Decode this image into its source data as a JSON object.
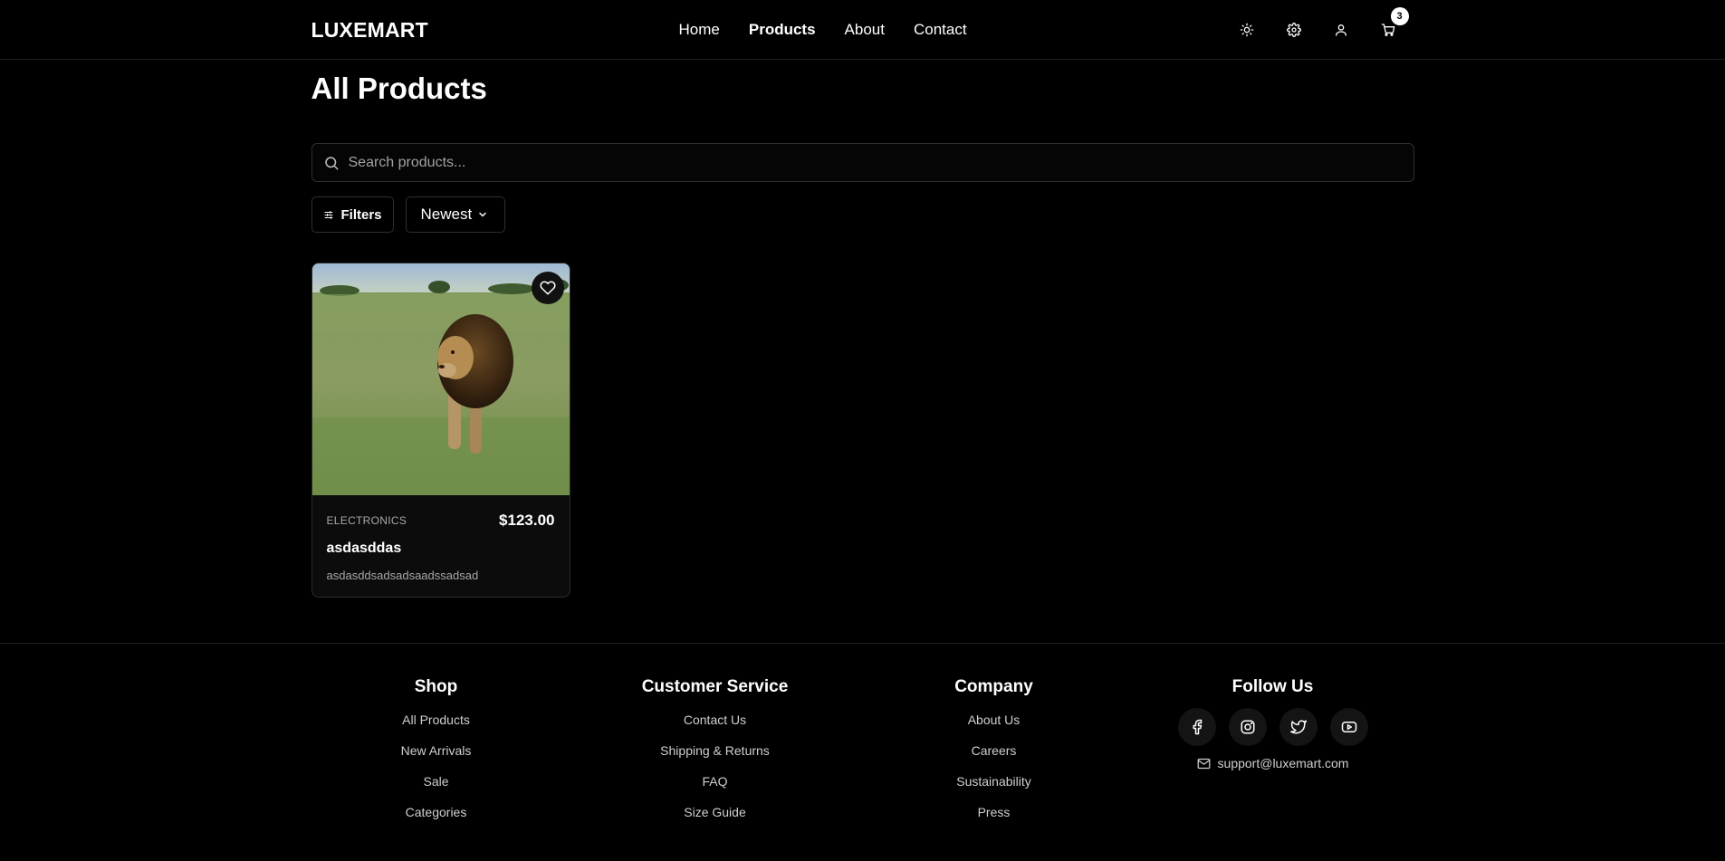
{
  "header": {
    "logo": "LUXEMART",
    "nav": [
      {
        "label": "Home",
        "active": false
      },
      {
        "label": "Products",
        "active": true
      },
      {
        "label": "About",
        "active": false
      },
      {
        "label": "Contact",
        "active": false
      }
    ],
    "icons": [
      "sun-icon",
      "gear-icon",
      "user-icon",
      "cart-icon"
    ],
    "cart_count": "3"
  },
  "main": {
    "title": "All Products",
    "search": {
      "placeholder": "Search products...",
      "value": ""
    },
    "filters_label": "Filters",
    "sort": {
      "selected": "Newest"
    }
  },
  "products": [
    {
      "category": "ELECTRONICS",
      "price": "$123.00",
      "name": "asdasddas",
      "description": "asdasddsadsadsaadssadsad",
      "image": "lion-in-grassland-photo"
    }
  ],
  "footer": {
    "columns": [
      {
        "title": "Shop",
        "links": [
          "All Products",
          "New Arrivals",
          "Sale",
          "Categories"
        ]
      },
      {
        "title": "Customer Service",
        "links": [
          "Contact Us",
          "Shipping & Returns",
          "FAQ",
          "Size Guide"
        ]
      },
      {
        "title": "Company",
        "links": [
          "About Us",
          "Careers",
          "Sustainability",
          "Press"
        ]
      }
    ],
    "follow": {
      "title": "Follow Us",
      "social_icons": [
        "facebook-icon",
        "instagram-icon",
        "twitter-icon",
        "youtube-icon"
      ],
      "email": "support@luxemart.com"
    }
  },
  "colors": {
    "background": "#000000",
    "text": "#ffffff",
    "muted_text": "#a8a8a8",
    "border": "#2e2e2e",
    "card_bg": "#0c0c0c"
  }
}
